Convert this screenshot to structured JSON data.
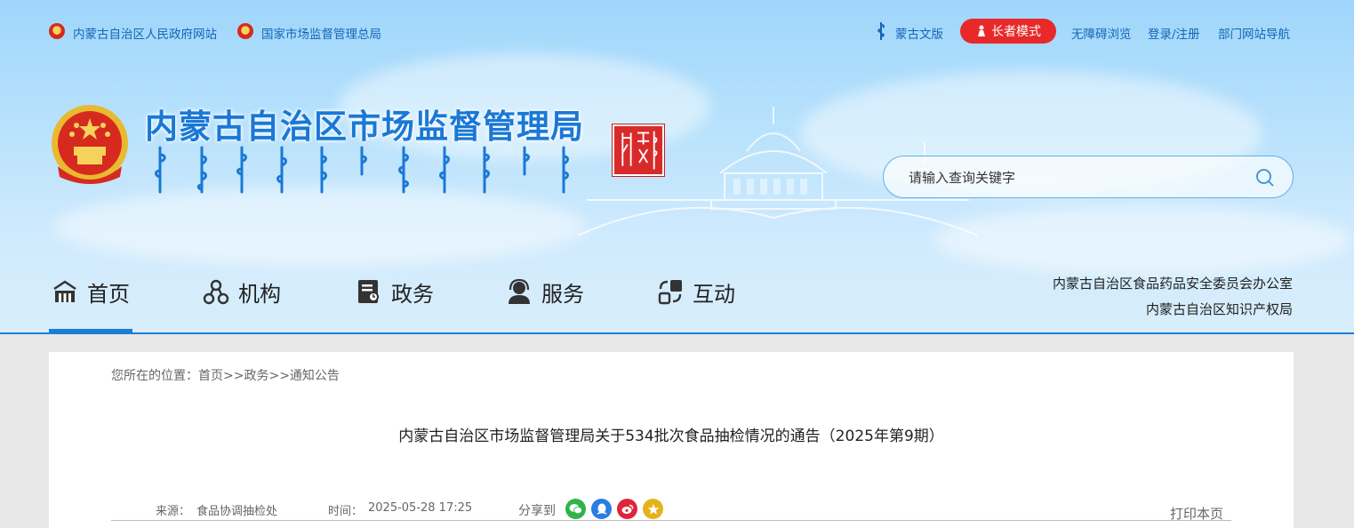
{
  "top": {
    "gov_link": "内蒙古自治区人民政府网站",
    "samr_link": "国家市场监督管理总局",
    "mongol_version": "蒙古文版",
    "elder_mode": "长者模式",
    "accessible": "无障碍浏览",
    "login": "登录/注册",
    "dept_nav": "部门网站导航"
  },
  "header": {
    "title": "内蒙古自治区市场监督管理局",
    "search_placeholder": "请输入查询关键字"
  },
  "nav": {
    "items": [
      {
        "label": "首页",
        "icon": "home-icon"
      },
      {
        "label": "机构",
        "icon": "org-icon"
      },
      {
        "label": "政务",
        "icon": "affairs-icon"
      },
      {
        "label": "服务",
        "icon": "service-icon"
      },
      {
        "label": "互动",
        "icon": "interact-icon"
      }
    ],
    "side_links": [
      "内蒙古自治区食品药品安全委员会办公室",
      "内蒙古自治区知识产权局"
    ]
  },
  "article": {
    "breadcrumb": "您所在的位置：首页>>政务>>通知公告",
    "title": "内蒙古自治区市场监督管理局关于534批次食品抽检情况的通告（2025年第9期）",
    "source_label": "来源：",
    "source": "食品协调抽检处",
    "time_label": "时间：",
    "time": "2025-05-28 17:25",
    "share_label": "分享到",
    "share_icons": [
      "wechat-icon",
      "qq-icon",
      "weibo-icon",
      "qzone-icon"
    ],
    "print": "打印本页"
  },
  "colors": {
    "accent": "#1a7fd4",
    "elder_btn": "#e8292a",
    "title": "#1a78d6"
  }
}
